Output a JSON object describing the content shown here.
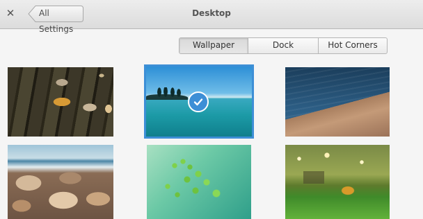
{
  "header": {
    "close_icon": "✕",
    "back_label": "All Settings",
    "title": "Desktop"
  },
  "modes": {
    "items": [
      "Wallpaper",
      "Dock",
      "Hot Corners"
    ],
    "active": "Wallpaper"
  },
  "wallpapers": {
    "items": [
      {
        "name": "wooden-planks-leaves",
        "selected": false
      },
      {
        "name": "lake-island-trees",
        "selected": true
      },
      {
        "name": "ocean-dock",
        "selected": false
      },
      {
        "name": "beach-rocks-waves",
        "selected": false
      },
      {
        "name": "green-fern-leaves",
        "selected": false
      },
      {
        "name": "grass-leaf-park",
        "selected": false
      }
    ],
    "selected_icon": "check-icon",
    "accent_color": "#3d8fd6"
  }
}
